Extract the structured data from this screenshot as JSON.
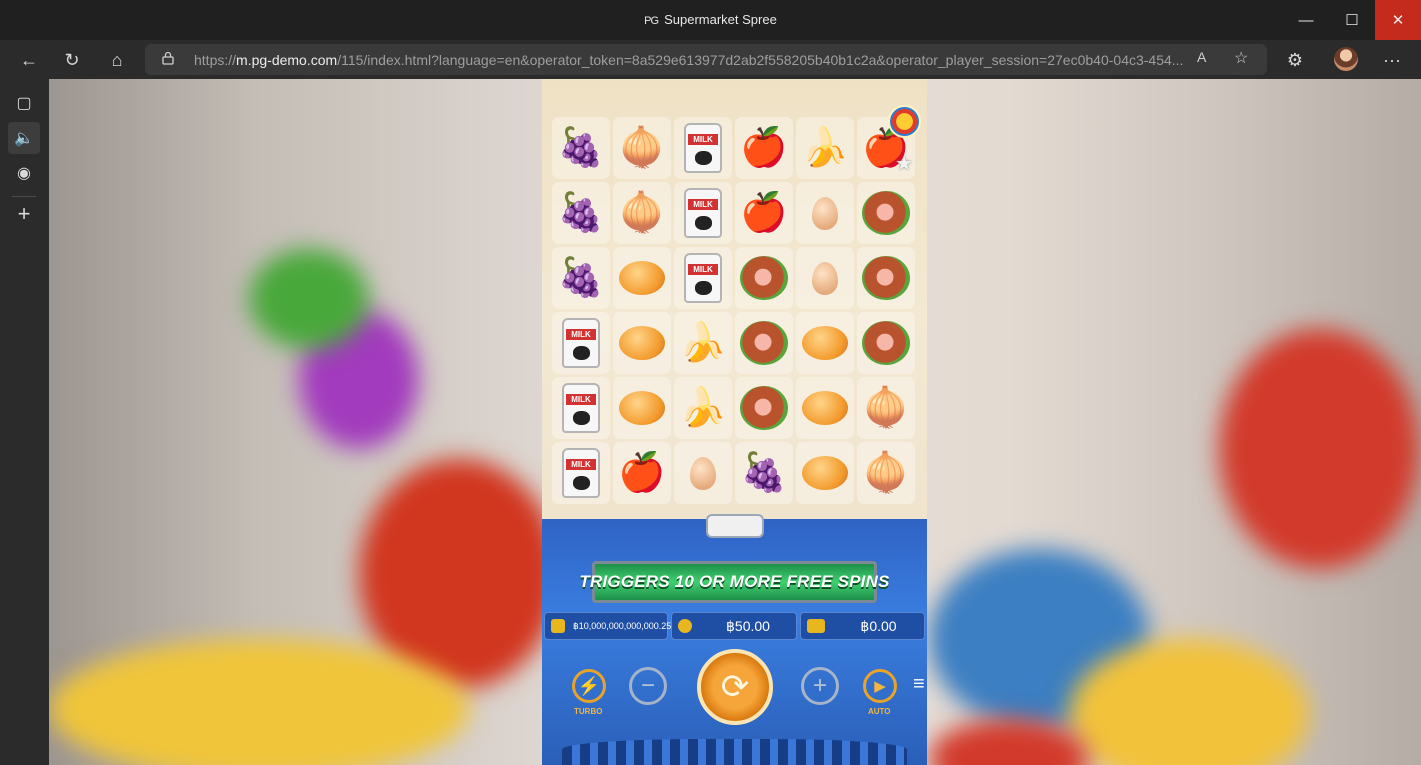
{
  "window": {
    "title": "Supermarket Spree",
    "minimize_icon": "—",
    "maximize_icon": "☐",
    "close_icon": "✕"
  },
  "toolbar": {
    "back_icon": "←",
    "reload_icon": "↻",
    "home_icon": "⌂",
    "url_prefix": "https://",
    "url_host": "m.pg-demo.com",
    "url_rest": "/115/index.html?language=en&operator_token=8a529e613977d2ab2f558205b40b1c2a&operator_player_session=27ec0b40-04c3-454...",
    "read_aloud_icon": "A",
    "favorites_icon": "☆",
    "extensions_icon": "⚙",
    "more_icon": "···"
  },
  "sidebar": {
    "tabs_icon": "▢",
    "audio_icon": "🔈",
    "ghost_icon": "◉",
    "add_icon": "+"
  },
  "game": {
    "grid": [
      [
        "grape",
        "onion",
        "milk",
        "apple",
        "banana",
        "apple"
      ],
      [
        "grape",
        "onion",
        "milk",
        "apple",
        "egg",
        "ham"
      ],
      [
        "grape",
        "bread",
        "milk",
        "ham",
        "egg",
        "ham"
      ],
      [
        "milk",
        "bread",
        "banana",
        "ham",
        "bread",
        "ham"
      ],
      [
        "milk",
        "bread",
        "banana",
        "ham",
        "bread",
        "onion"
      ],
      [
        "milk",
        "apple",
        "egg",
        "grape",
        "bread",
        "onion"
      ]
    ],
    "symbols": {
      "grape": "🍇",
      "onion": "🧅",
      "apple": "🍎",
      "banana": "🍌"
    },
    "milk_label": "MILK",
    "star_icon": "★",
    "banner": "TRIGGERS 10 OR MORE FREE SPINS",
    "balance": "฿10,000,000,000,000.25",
    "bet": "฿50.00",
    "win": "฿0.00",
    "turbo_label": "TURBO",
    "auto_label": "AUTO",
    "turbo_icon": "⚡",
    "minus_icon": "−",
    "spin_icon": "⟳",
    "plus_icon": "+",
    "auto_icon": "▶",
    "menu_icon": "≡"
  }
}
